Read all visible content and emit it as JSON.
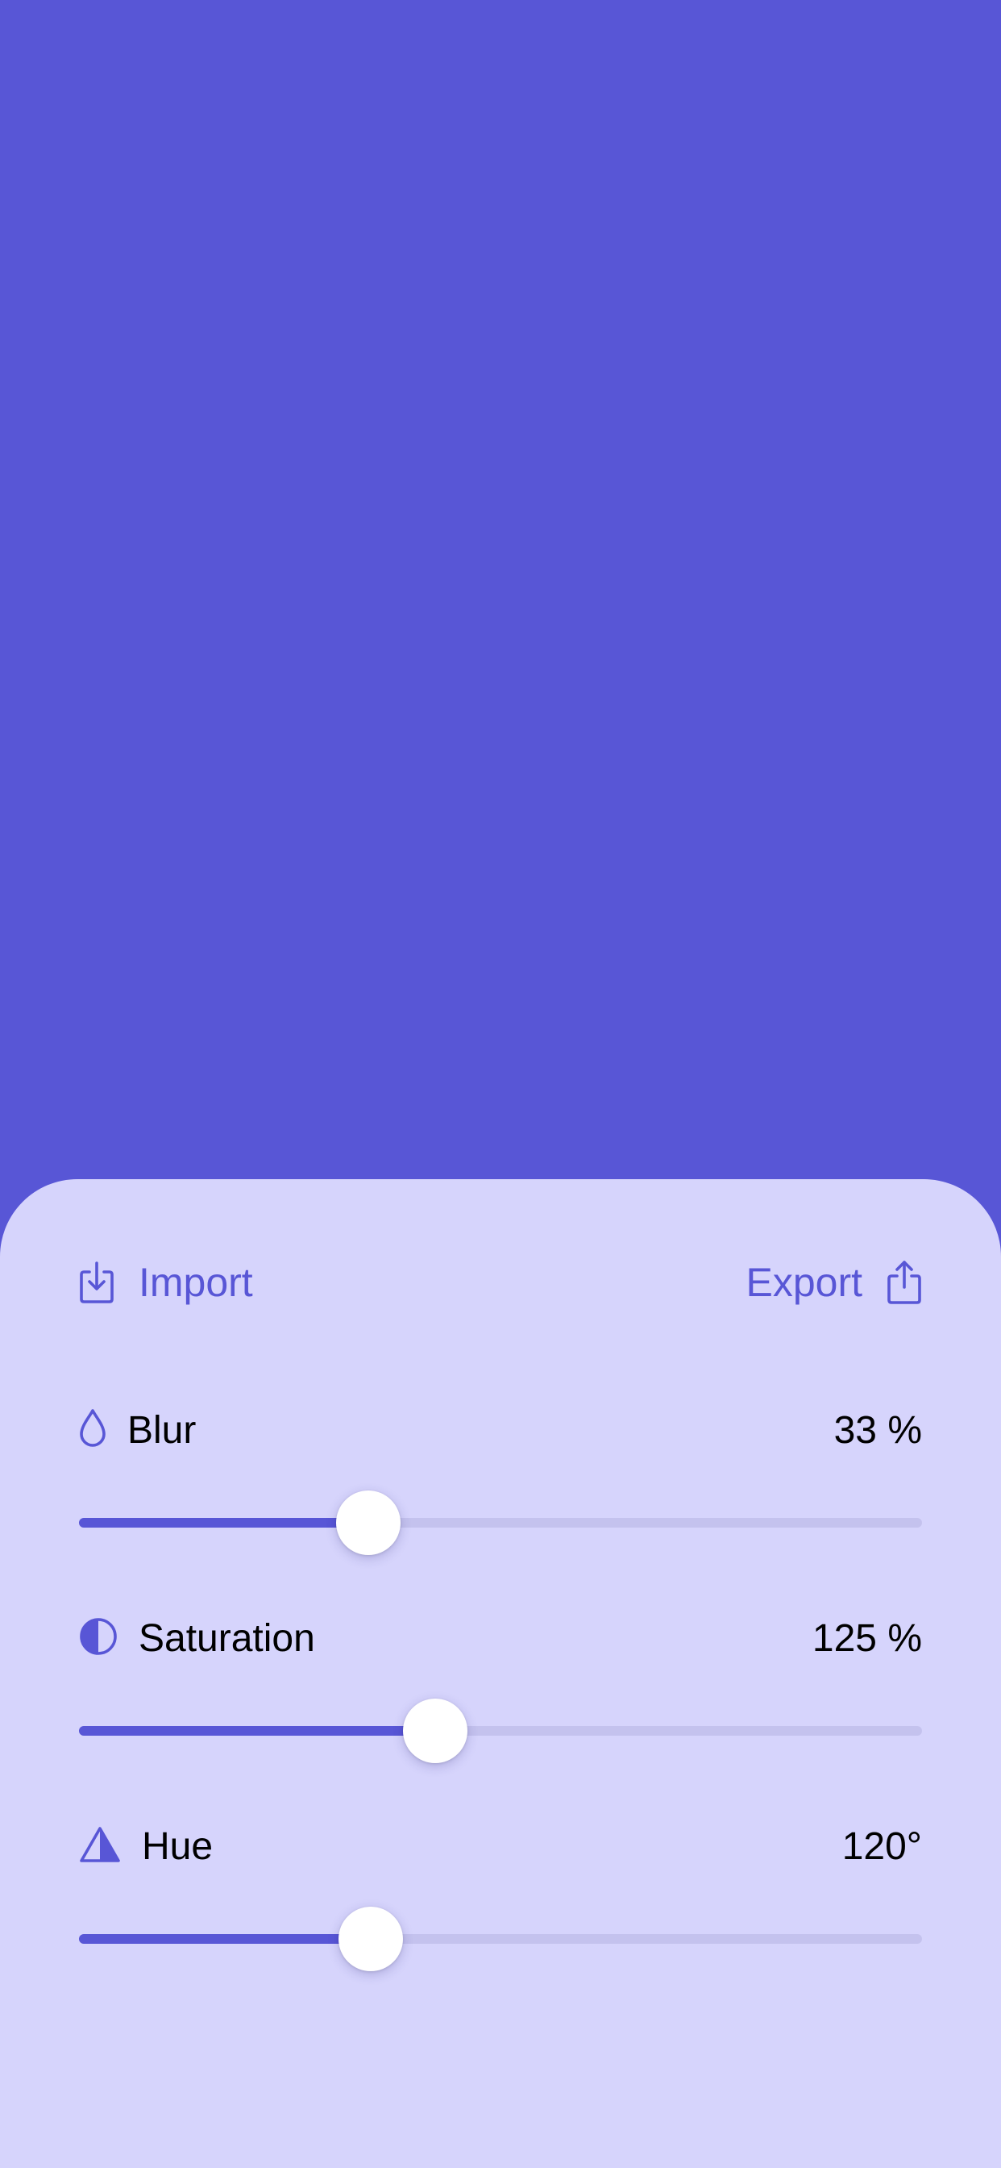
{
  "colors": {
    "accent": "#5856D6",
    "panel_background": "#D6D4FC",
    "track": "#C4C2EE",
    "thumb": "#FFFFFF",
    "text": "#000000"
  },
  "actions": {
    "import_label": "Import",
    "import_icon": "import-icon",
    "export_label": "Export",
    "export_icon": "export-icon"
  },
  "controls": [
    {
      "id": "blur",
      "label": "Blur",
      "value_text": "33 %",
      "icon": "drop-icon",
      "fraction": 0.343
    },
    {
      "id": "saturation",
      "label": "Saturation",
      "value_text": "125 %",
      "icon": "half-circle-icon",
      "fraction": 0.423
    },
    {
      "id": "hue",
      "label": "Hue",
      "value_text": "120°",
      "icon": "triangle-half-icon",
      "fraction": 0.346
    }
  ]
}
